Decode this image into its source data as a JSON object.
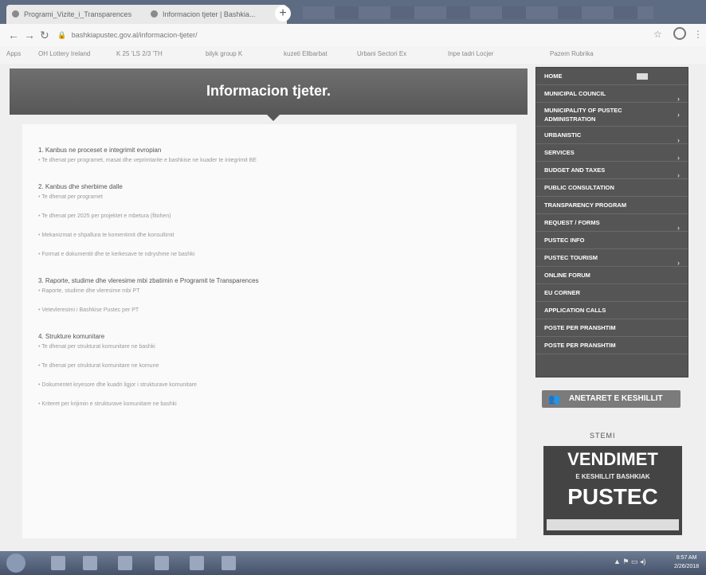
{
  "browser": {
    "tabs": [
      {
        "label": "Programi_Vizite_i_Transparences"
      },
      {
        "label": "Informacion tjeter | Bashkia..."
      }
    ],
    "url": "bashkiapustec.gov.al/informacion-tjeter/",
    "bookmarks": [
      "Apps",
      "OH Lottery Ireland",
      "K 25 'LS 2/3 'TH",
      "bilyk group K",
      "kuzeti Ellbarbat",
      "Urbani Sectori Ex",
      "Inpe tadri Locjer",
      "Pazem Rubrika"
    ]
  },
  "header": {
    "title": "Informacion tjeter."
  },
  "content": {
    "sections": [
      {
        "title": "1. Kanbus ne proceset e integrimit evropian",
        "items": [
          "Te dhenat per programet, masat dhe veprimtarite e bashkise ne kuader te integrimit BE"
        ]
      },
      {
        "title": "2. Kanbus dhe sherbime dalle",
        "items": [
          "Te dhenat per programet",
          "Te dhenat per 2025 per projektet e mbetura (fitohen)",
          "Mekanizmat e shpallura te komentimit dhe konsultimit",
          "Format e dokumentit dhe te kerkesave te ndryshme ne bashki"
        ]
      },
      {
        "title": "3. Raporte, studime dhe vleresime mbi zbatimin e Programit te Transparences",
        "items": [
          "Raporte, studime dhe vleresime mbi PT",
          "Vetevleresimi i Bashkise Pustec per PT"
        ]
      },
      {
        "title": "4. Strukture komunitare",
        "items": [
          "Te dhenat per strukturat komunitare ne bashki",
          "Te dhenat per strukturat komunitare ne komune",
          "Dokumentet kryesore dhe kuadri ligjor i strukturave komunitare",
          "Kriteret per krijimin e strukturave komunitare ne bashki"
        ]
      }
    ]
  },
  "menu": {
    "items": [
      {
        "label": "HOME",
        "arrow": false
      },
      {
        "label": "MUNICIPAL COUNCIL",
        "arrow": true
      },
      {
        "label": "MUNICIPALITY OF PUSTEC ADMINISTRATION",
        "arrow": true
      },
      {
        "label": "URBANISTIC",
        "arrow": true
      },
      {
        "label": "SERVICES",
        "arrow": true
      },
      {
        "label": "BUDGET AND TAXES",
        "arrow": true
      },
      {
        "label": "PUBLIC CONSULTATION",
        "arrow": false
      },
      {
        "label": "TRANSPARENCY PROGRAM",
        "arrow": false
      },
      {
        "label": "REQUEST / FORMS",
        "arrow": true
      },
      {
        "label": "PUSTEC INFO",
        "arrow": false
      },
      {
        "label": "PUSTEC TOURISM",
        "arrow": true
      },
      {
        "label": "ONLINE FORUM",
        "arrow": false
      },
      {
        "label": "EU CORNER",
        "arrow": false
      },
      {
        "label": "APPLICATION CALLS",
        "arrow": false
      },
      {
        "label": "POSTE PER PRANSHTIM",
        "arrow": false
      },
      {
        "label": "POSTE PER PRANSHTIM",
        "arrow": false
      }
    ]
  },
  "sidebar": {
    "members_button": "ANETARET E KESHILLIT",
    "banner_tag": "STEMI",
    "banner": {
      "line1": "VENDIMET",
      "line2": "E KESHILLIT BASHKIAK",
      "line3": "PUSTEC"
    }
  },
  "taskbar": {
    "time": "8:57 AM",
    "date": "2/26/2018"
  }
}
